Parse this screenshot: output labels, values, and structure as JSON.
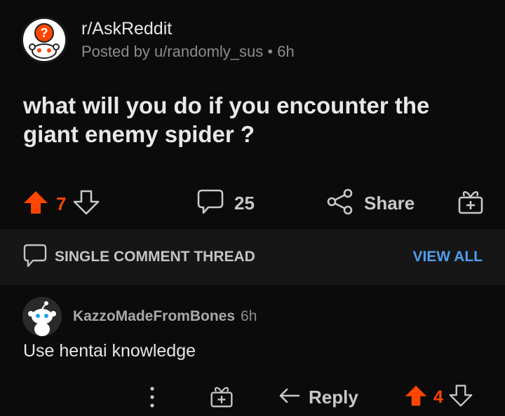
{
  "post": {
    "subreddit": "r/AskReddit",
    "posted_by": "Posted by u/randomly_sus",
    "separator": "•",
    "age": "6h",
    "title": "what will you do if you encounter the giant enemy spider ?",
    "votes": "7",
    "comments": "25",
    "share_label": "Share"
  },
  "thread": {
    "label": "SINGLE COMMENT THREAD",
    "view_all": "VIEW ALL"
  },
  "comment": {
    "author": "KazzoMadeFromBones",
    "age": "6h",
    "body": "Use hentai knowledge",
    "reply_label": "Reply",
    "votes": "4"
  },
  "colors": {
    "upvote": "#ff4500",
    "link": "#4f9eed",
    "background": "#0b0b0b"
  },
  "icons": [
    "subreddit-avatar",
    "upvote-icon",
    "downvote-icon",
    "comment-icon",
    "share-icon",
    "award-icon",
    "chat-icon",
    "more-icon",
    "reply-icon"
  ]
}
